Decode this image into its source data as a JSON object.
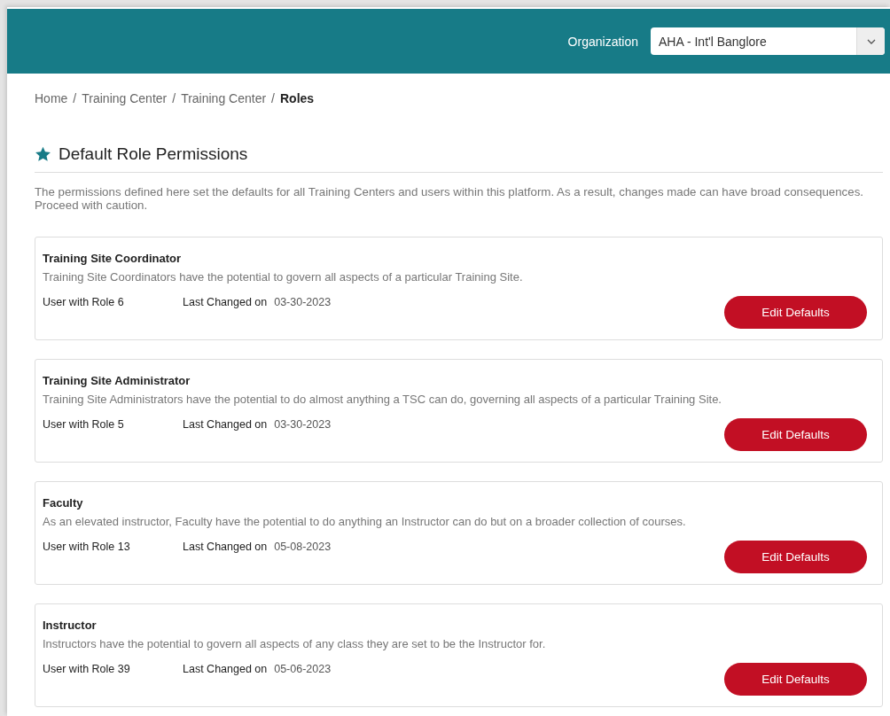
{
  "header": {
    "organization_label": "Organization",
    "organization_select": {
      "value": "AHA - Int'l Banglore"
    }
  },
  "breadcrumb": [
    {
      "label": "Home",
      "current": false
    },
    {
      "separator": "/",
      "label": "Training Center",
      "current": false
    },
    {
      "separator": "/",
      "label": "Training Center",
      "current": false
    },
    {
      "separator": "/",
      "label": "Roles",
      "current": true
    }
  ],
  "page_title": "Default Role Permissions",
  "description": "The permissions defined here set the defaults for all Training Centers and users within this platform. As a result, changes made can have broad consequences. Proceed with caution.",
  "roles": [
    {
      "name": "Training Site Coordinator",
      "description": "Training Site Coordinators have the potential to govern all aspects of a particular Training Site.",
      "users": "User with Role 6",
      "last_changed_label": "Last Changed on",
      "last_changed": "03-30-2023",
      "button": "Edit Defaults"
    },
    {
      "name": "Training Site Administrator",
      "description": "Training Site Administrators have the potential to do almost anything a TSC can do, governing all aspects of a particular Training Site.",
      "users": "User with Role 5",
      "last_changed_label": "Last Changed on",
      "last_changed": "03-30-2023",
      "button": "Edit Defaults"
    },
    {
      "name": "Faculty",
      "description": "As an elevated instructor, Faculty have the potential to do anything an Instructor can do but on a broader collection of courses.",
      "users": "User with Role 13",
      "last_changed_label": "Last Changed on",
      "last_changed": "05-08-2023",
      "button": "Edit Defaults"
    },
    {
      "name": "Instructor",
      "description": "Instructors have the potential to govern all aspects of any class they are set to be the Instructor for.",
      "users": "User with Role 39",
      "last_changed_label": "Last Changed on",
      "last_changed": "05-06-2023",
      "button": "Edit Defaults"
    }
  ]
}
